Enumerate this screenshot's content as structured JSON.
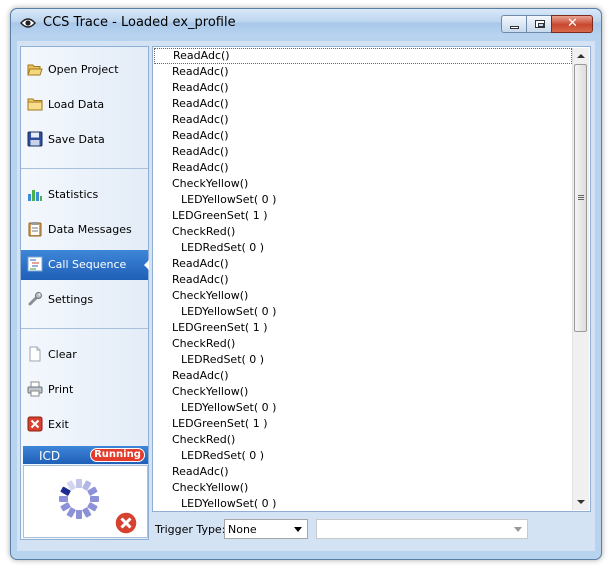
{
  "window": {
    "title": "CCS Trace - Loaded ex_profile",
    "accent_color": "#1f5fb7",
    "titlebar_buttons": [
      "minimize-button",
      "maximize-button",
      "close-button"
    ]
  },
  "sidebar": {
    "items": [
      {
        "label": "Open Project",
        "icon": "folder-open-icon"
      },
      {
        "label": "Load Data",
        "icon": "folder-icon"
      },
      {
        "label": "Save Data",
        "icon": "floppy-disk-icon"
      },
      {
        "label": "Statistics",
        "icon": "bar-chart-icon"
      },
      {
        "label": "Data Messages",
        "icon": "clipboard-icon"
      },
      {
        "label": "Call Sequence",
        "icon": "call-sequence-icon",
        "selected": true
      },
      {
        "label": "Settings",
        "icon": "wrench-icon"
      },
      {
        "label": "Clear",
        "icon": "blank-page-icon"
      },
      {
        "label": "Print",
        "icon": "printer-icon"
      },
      {
        "label": "Exit",
        "icon": "exit-icon"
      }
    ],
    "icd": {
      "label": "ICD",
      "status": "Running",
      "status_color": "#e33c2c"
    }
  },
  "call_sequence": {
    "rows": [
      {
        "text": "ReadAdc()",
        "indent": 1
      },
      {
        "text": "ReadAdc()",
        "indent": 1
      },
      {
        "text": "ReadAdc()",
        "indent": 1
      },
      {
        "text": "ReadAdc()",
        "indent": 1
      },
      {
        "text": "ReadAdc()",
        "indent": 1
      },
      {
        "text": "ReadAdc()",
        "indent": 1
      },
      {
        "text": "ReadAdc()",
        "indent": 1
      },
      {
        "text": "ReadAdc()",
        "indent": 1
      },
      {
        "text": "CheckYellow()",
        "indent": 1
      },
      {
        "text": "LEDYellowSet( 0 )",
        "indent": 2
      },
      {
        "text": "LEDGreenSet( 1 )",
        "indent": 1
      },
      {
        "text": "CheckRed()",
        "indent": 1
      },
      {
        "text": "LEDRedSet( 0 )",
        "indent": 2
      },
      {
        "text": "ReadAdc()",
        "indent": 1
      },
      {
        "text": "ReadAdc()",
        "indent": 1
      },
      {
        "text": "CheckYellow()",
        "indent": 1
      },
      {
        "text": "LEDYellowSet( 0 )",
        "indent": 2
      },
      {
        "text": "LEDGreenSet( 1 )",
        "indent": 1
      },
      {
        "text": "CheckRed()",
        "indent": 1
      },
      {
        "text": "LEDRedSet( 0 )",
        "indent": 2
      },
      {
        "text": "ReadAdc()",
        "indent": 1
      },
      {
        "text": "CheckYellow()",
        "indent": 1
      },
      {
        "text": "LEDYellowSet( 0 )",
        "indent": 2
      },
      {
        "text": "LEDGreenSet( 1 )",
        "indent": 1
      },
      {
        "text": "CheckRed()",
        "indent": 1
      },
      {
        "text": "LEDRedSet( 0 )",
        "indent": 2
      },
      {
        "text": "ReadAdc()",
        "indent": 1
      },
      {
        "text": "CheckYellow()",
        "indent": 1
      },
      {
        "text": "LEDYellowSet( 0 )",
        "indent": 2
      }
    ]
  },
  "trigger": {
    "label": "Trigger Type:",
    "type_value": "None",
    "secondary_value": ""
  }
}
